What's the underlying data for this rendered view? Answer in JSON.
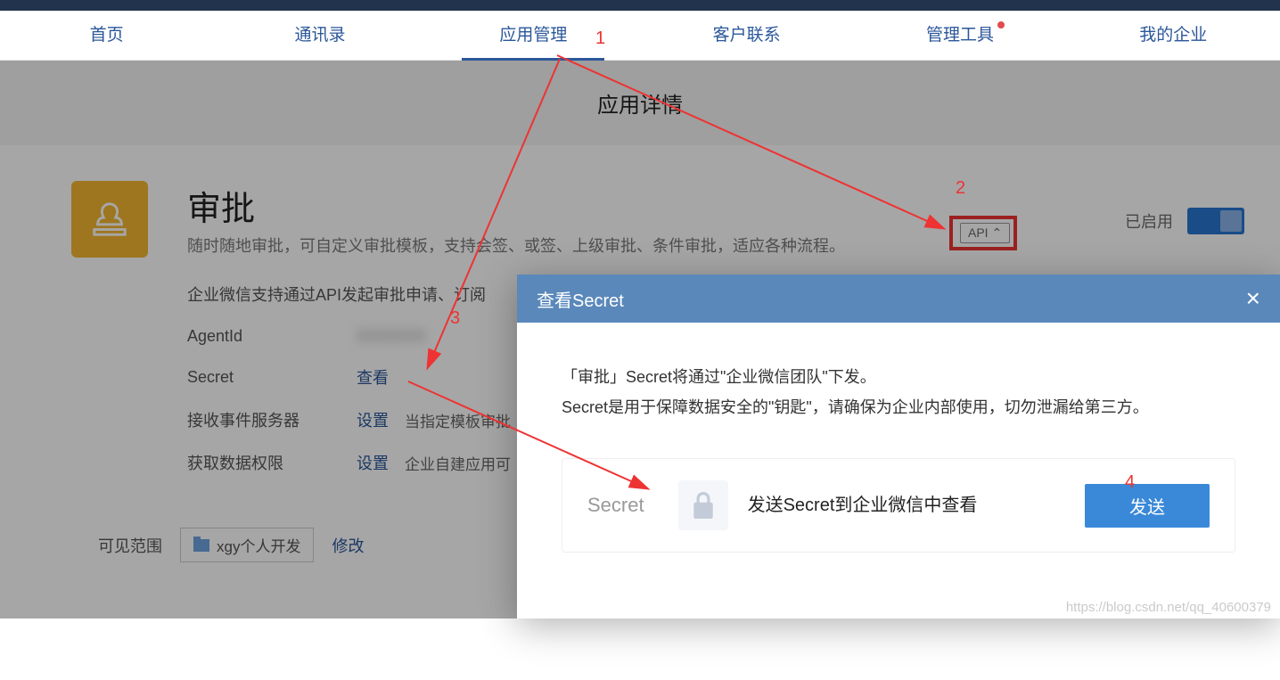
{
  "nav": {
    "items": [
      "首页",
      "通讯录",
      "应用管理",
      "客户联系",
      "管理工具",
      "我的企业"
    ],
    "active_index": 2
  },
  "annotations": {
    "n1": "1",
    "n2": "2",
    "n3": "3",
    "n4": "4"
  },
  "page": {
    "title": "应用详情"
  },
  "app": {
    "name": "审批",
    "desc": "随时随地审批，可自定义审批模板，支持会签、或签、上级审批、条件审批，适应各种流程。",
    "api_button": "API ⌃",
    "status_label": "已启用",
    "sub_desc": "企业微信支持通过API发起审批申请、订阅",
    "fields": {
      "agent_label": "AgentId",
      "agent_value": "XXXXXX",
      "secret_label": "Secret",
      "secret_link": "查看",
      "server_label": "接收事件服务器",
      "server_link": "设置",
      "server_text": "当指定模板审批",
      "perm_label": "获取数据权限",
      "perm_link": "设置",
      "perm_text": "企业自建应用可"
    },
    "visible": {
      "label": "可见范围",
      "tag": "xgy个人开发",
      "modify": "修改"
    }
  },
  "modal": {
    "title": "查看Secret",
    "line1": "「审批」Secret将通过\"企业微信团队\"下发。",
    "line2": "Secret是用于保障数据安全的\"钥匙\"，请确保为企业内部使用，切勿泄漏给第三方。",
    "secret_label": "Secret",
    "send_desc": "发送Secret到企业微信中查看",
    "send_btn": "发送"
  },
  "watermark": "https://blog.csdn.net/qq_40600379"
}
